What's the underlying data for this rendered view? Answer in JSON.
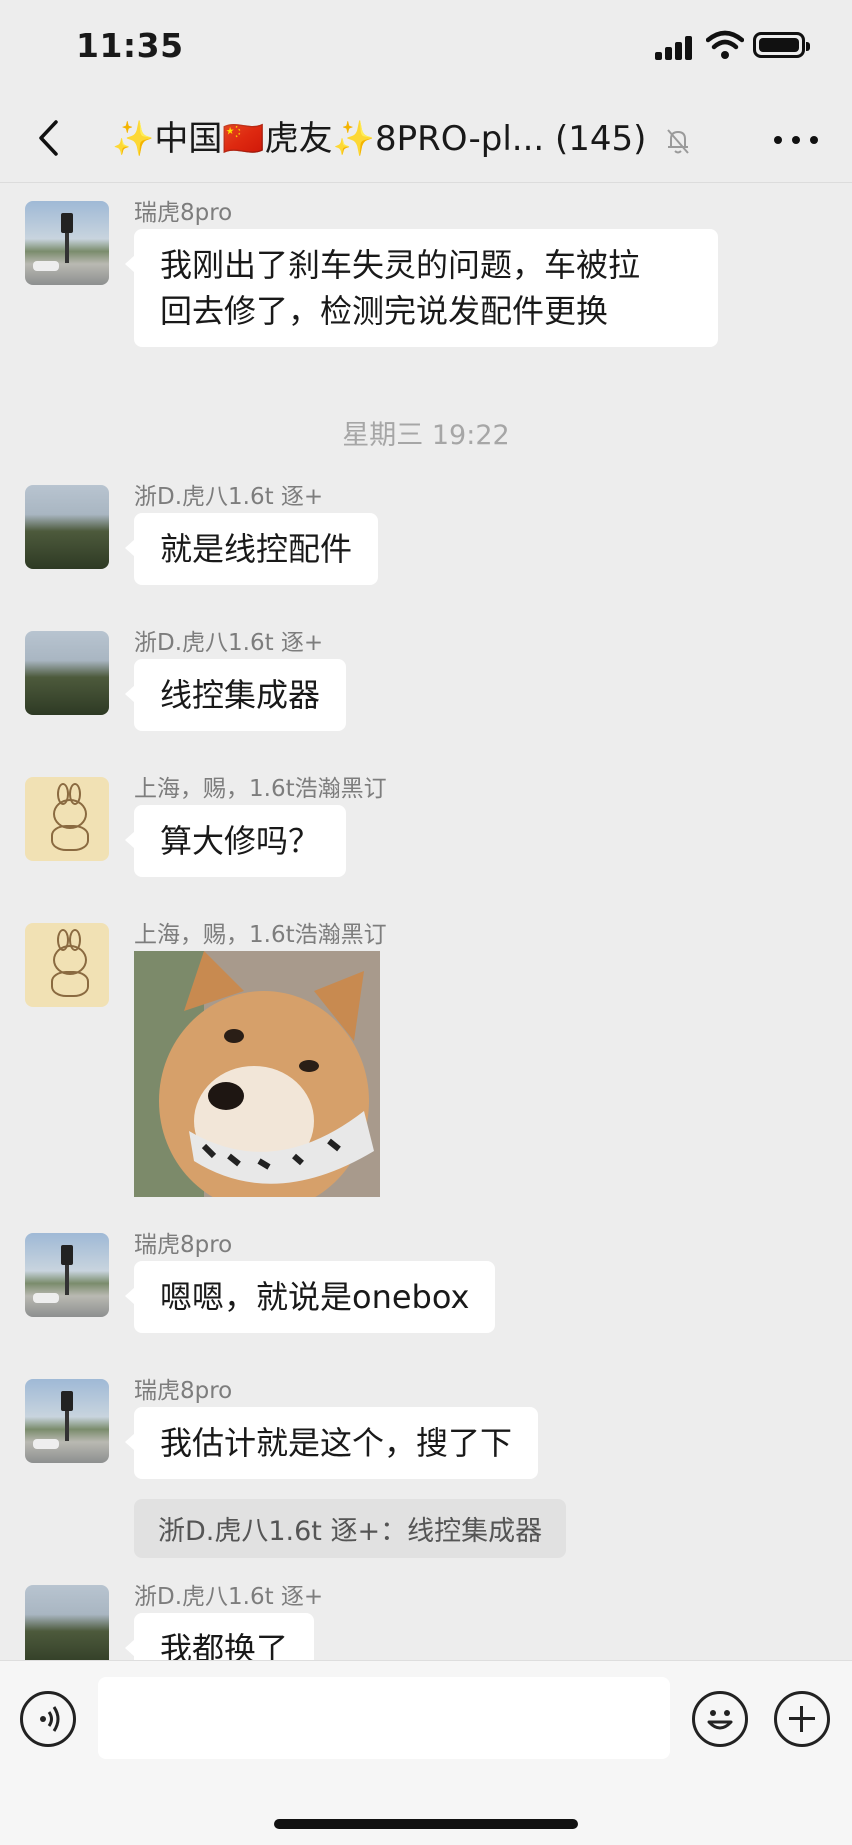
{
  "status": {
    "time": "11:35"
  },
  "header": {
    "title": "✨中国🇨🇳虎友✨8PRO-pl...",
    "member_count": "(145)"
  },
  "messages": [
    {
      "type": "text",
      "sender": "瑞虎8pro",
      "avatar": "street-avatar",
      "text_lines": [
        "我刚出了刹车失灵的问题，车被拉",
        "回去修了，检测完说发配件更换"
      ]
    },
    {
      "type": "time",
      "text": "星期三 19:22"
    },
    {
      "type": "text",
      "sender": "浙D.虎八1.6t 逐+",
      "avatar": "tree-avatar",
      "text": "就是线控配件"
    },
    {
      "type": "text",
      "sender": "浙D.虎八1.6t 逐+",
      "avatar": "tree-avatar",
      "text": "线控集成器"
    },
    {
      "type": "text",
      "sender": "上海，赐，1.6t浩瀚黑订",
      "avatar": "bunny-avatar",
      "text": "算大修吗？"
    },
    {
      "type": "sticker",
      "sender": "上海，赐，1.6t浩瀚黑订",
      "avatar": "bunny-avatar",
      "sticker": "shiba-dog-sticker"
    },
    {
      "type": "text",
      "sender": "瑞虎8pro",
      "avatar": "street-avatar",
      "text": "嗯嗯，就说是onebox"
    },
    {
      "type": "text",
      "sender": "瑞虎8pro",
      "avatar": "street-avatar",
      "text": "我估计就是这个，搜了下",
      "quote": "浙D.虎八1.6t 逐+：线控集成器"
    },
    {
      "type": "text",
      "sender": "浙D.虎八1.6t 逐+",
      "avatar": "tree-avatar",
      "text": "我都换了"
    }
  ],
  "icons": {
    "back": "chevron-left-icon",
    "mute": "bell-muted-icon",
    "more": "more-dots-icon",
    "voice": "voice-icon",
    "emoji": "emoji-icon",
    "plus": "plus-icon"
  }
}
